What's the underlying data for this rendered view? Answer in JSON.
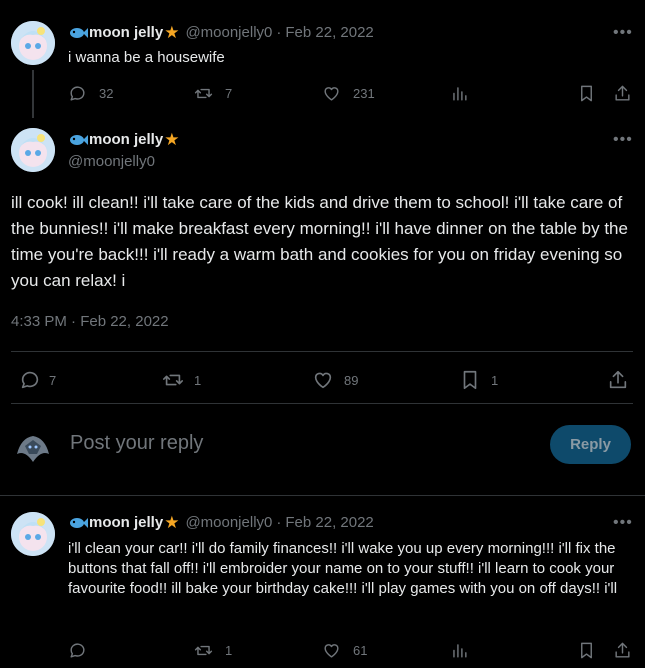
{
  "tweet1": {
    "name": "moon jelly",
    "handle": "@moonjelly0",
    "sep": "·",
    "date": "Feb 22, 2022",
    "text": "i wanna be a housewife",
    "replies": "32",
    "retweets": "7",
    "likes": "231"
  },
  "main": {
    "name": "moon jelly",
    "handle": "@moonjelly0",
    "text": "ill cook! ill clean!! i'll take care of the kids and drive them to school! i'll take care of the bunnies!! i'll make breakfast every morning!! i'll have dinner on the table by the time you're back!!! i'll ready a warm bath and cookies for you on friday evening so you can relax! i",
    "timestamp": "4:33 PM · Feb 22, 2022",
    "replies": "7",
    "retweets": "1",
    "likes": "89",
    "bookmarks": "1"
  },
  "compose": {
    "placeholder": "Post your reply",
    "button": "Reply"
  },
  "tweet3": {
    "name": "moon jelly",
    "handle": "@moonjelly0",
    "sep": "·",
    "date": "Feb 22, 2022",
    "text": "i'll clean your car!! i'll do family finances!! i'll wake you up every morning!!! i'll fix the buttons that fall off!! i'll embroider your name on to your stuff!! i'll learn to cook your favourite food!! ill bake your birthday cake!!! i'll play games with you on off days!! i'll",
    "replies": "",
    "retweets": "1",
    "likes": "61"
  },
  "icons": {
    "more": "more-icon",
    "reply": "reply-icon",
    "retweet": "retweet-icon",
    "like": "heart-icon",
    "views": "views-icon",
    "bookmark": "bookmark-icon",
    "share": "share-icon"
  },
  "colors": {
    "background": "#000000",
    "text": "#e7e9ea",
    "muted": "#71767b",
    "star": "#f5a623",
    "fish": "#4aa3df",
    "reply_button": "#0e4a6b"
  }
}
